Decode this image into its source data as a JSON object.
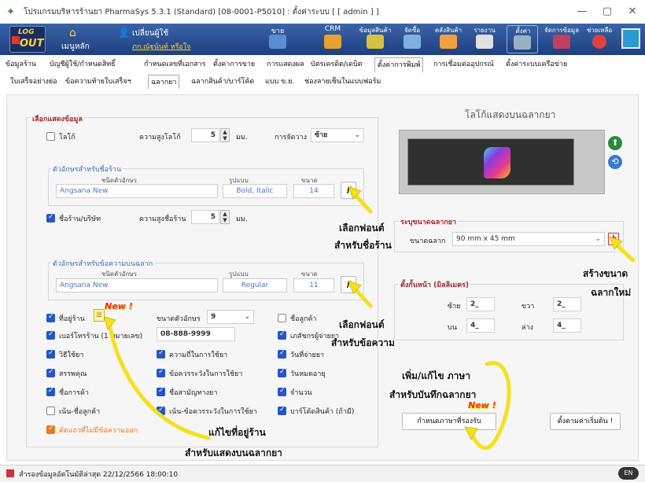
{
  "window": {
    "title": "โปรแกรมบริหารร้านยา PharmaSys 5.3.1 (Standard) [08-0001-P5010] : ตั้งค่าระบบ  [ [ admin ] ]",
    "minimize": "—",
    "maximize": "▢",
    "close": "✕"
  },
  "toolbar": {
    "logout_top": "LOG",
    "logout_bottom": "OUT",
    "home_label": "เมนูหลัก",
    "change_user_label": "เปลี่ยนผู้ใช้",
    "user_name": "ภก.ณัฐนันท์ หรือใจ",
    "buttons": [
      "ขาย",
      "CRM",
      "ข้อมูลสินค้า",
      "จัดซื้อ",
      "คลังสินค้า",
      "รายงาน",
      "ตั้งค่า",
      "จัดการข้อมูล",
      "ช่วยเหลือ"
    ]
  },
  "tabs_primary": [
    "ข้อมูลร้าน",
    "บัญชีผู้ใช้/กำหนดสิทธิ์",
    "กำหนดเลขที่เอกสาร",
    "ตั้งค่าการขาย",
    "การแสดงผล",
    "บัตรเครดิต/เดบิต",
    "ตั้งค่าการพิมพ์",
    "การเชื่อมต่ออุปกรณ์",
    "ตั้งค่าระบบเครือข่าย"
  ],
  "tabs_secondary": [
    "ใบเสร็จอย่างย่อ",
    "ข้อความท้ายใบเสร็จฯ",
    "ฉลากยา",
    "ฉลากสินค้า/บาร์โค้ด",
    "แบบ ข.ย.",
    "ช่องลายเซ็นในแบบฟอร์ม"
  ],
  "display_section": {
    "title": "เลือกแสดงข้อมูล",
    "logo_label": "โลโก้",
    "logo_height_label": "ความสูงโลโก้",
    "logo_height_value": "5",
    "unit_mm": "มม.",
    "alignment_label": "การจัดวาง",
    "alignment_value": "ซ้าย",
    "shop_font_group": "ตัวอักษรสำหรับชื่อร้าน",
    "font_type_header": "ชนิดตัวอักษร",
    "style_header": "รูปแบบ",
    "size_header": "ขนาด",
    "shop_font_name": "Angsana New",
    "shop_font_style": "Bold, Italic",
    "shop_font_size": "14",
    "font_button": "f",
    "shop_name_label": "ชื่อร้าน/บริษัท",
    "shop_name_height_label": "ความสูงชื่อร้าน",
    "shop_name_height_value": "5",
    "label_font_group": "ตัวอักษรสำหรับข้อความบนฉลาก",
    "label_font_name": "Angsana New",
    "label_font_style": "Regular",
    "label_font_size": "11",
    "address_label": "ที่อยู่ร้าน",
    "font_size_label": "ขนาดตัวอักษร",
    "font_size_value": "9",
    "customer_name_label": "ชื่อลูกค้า",
    "phone_label": "เบอร์โทรร้าน (1 หมายเลข)",
    "phone_value": "08-888-9999",
    "pharmacist_label": "เภสัชกรผู้จ่ายยา",
    "usage_label": "วิธีใช้ยา",
    "purpose_label": "ความถี่ในการใช้ยา",
    "dispense_date_label": "วันที่จ่ายยา",
    "properties_label": "สรรพคุณ",
    "caution_label": "ข้อควรระวังในการใช้ยา",
    "expiry_label": "วันหมดอายุ",
    "trade_name_label": "ชื่อการค้า",
    "generic_name_label": "ชื่อสามัญทางยา",
    "quantity_label": "จำนวน",
    "highlight_customer_label": "เน้น-ชื่อลูกค้า",
    "highlight_caution_label": "เน้น-ข้อควรระวังในการใช้ยา",
    "barcode_label": "บาร์โค้ดสินค้า (ถ้ามี)",
    "cut_line_label": "ตัดแถวที่ไม่มีข้อความออก"
  },
  "logo_section": {
    "title": "โลโก้แสดงบนฉลากยา"
  },
  "size_section": {
    "title": "ระบุขนาดฉลากยา",
    "size_label": "ขนาดฉลาก",
    "size_value": "90 mm x 45 mm"
  },
  "margin_section": {
    "title": "ตั้งกั้นหน้า (มิลลิเมตร)",
    "left_label": "ซ้าย",
    "left_value": "2_",
    "right_label": "ขวา",
    "right_value": "2_",
    "top_label": "บน",
    "top_value": "4_",
    "bottom_label": "ล่าง",
    "bottom_value": "4_"
  },
  "buttons": {
    "language": "กำหนดภาษาที่รองรับ",
    "reset": "ตั้งตามค่าเริ่มต้น !"
  },
  "annotations": {
    "font_shop_1": "เลือกฟอนต์",
    "font_shop_2": "สำหรับชื่อร้าน",
    "font_label_1": "เลือกฟอนต์",
    "font_label_2": "สำหรับข้อความ",
    "new_size_1": "สร้างขนาด",
    "new_size_2": "ฉลากใหม่",
    "language_1": "เพิ่ม/แก้ไข ภาษา",
    "language_2": "สำหรับบันทึกฉลากยา",
    "address_1": "แก้ไขที่อยู่ร้าน",
    "address_2": "สำหรับแสดงบนฉลากยา",
    "new_badge": "New !"
  },
  "status": {
    "text": "สำรองข้อมูลอัตโนมัติล่าสุด  22/12/2566 18:00:10",
    "right": "EN"
  },
  "colors": {
    "accent": "#2456c8",
    "title_red": "#a0282b",
    "toolbar_blue": "#2a4f92",
    "arrow_yellow": "#f5e020"
  }
}
